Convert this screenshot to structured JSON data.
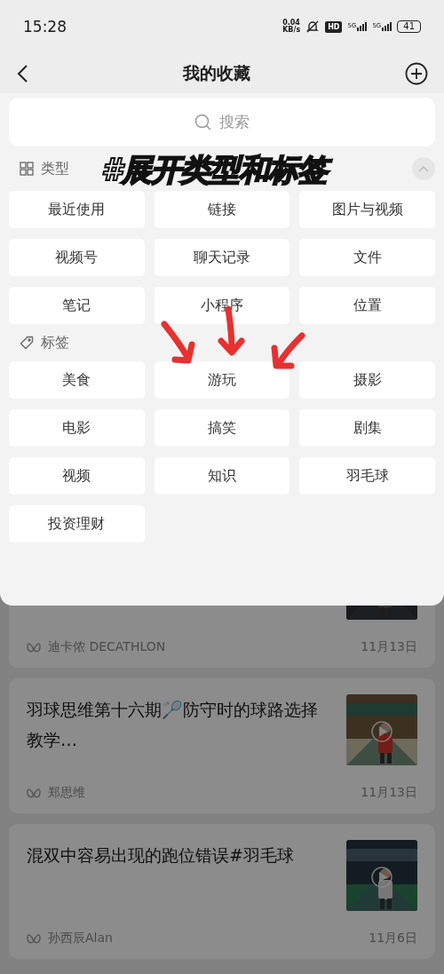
{
  "status_bar": {
    "time": "15:28",
    "net_speed": [
      "0.04",
      "KB/s"
    ],
    "hd": "HD",
    "signals": [
      "5G",
      "5G"
    ],
    "battery": "41"
  },
  "header": {
    "title": "我的收藏"
  },
  "search": {
    "placeholder": "搜索"
  },
  "sections": [
    {
      "kind": "types",
      "title": "类型",
      "expanded": true,
      "items": [
        "最近使用",
        "链接",
        "图片与视频",
        "视频号",
        "聊天记录",
        "文件",
        "笔记",
        "小程序",
        "位置"
      ]
    },
    {
      "kind": "tags",
      "title": "标签",
      "items": [
        "美食",
        "游玩",
        "摄影",
        "电影",
        "搞笑",
        "剧集",
        "视频",
        "知识",
        "羽毛球",
        "投资理财"
      ]
    }
  ],
  "annotation": {
    "caption": "#展开类型和标签"
  },
  "list": [
    {
      "author": "迪卡侬 DECATHLON",
      "date": "11月13日"
    },
    {
      "title": "羽球思维第十六期🏸防守时的球路选择教学…",
      "author": "郑思维",
      "date": "11月13日"
    },
    {
      "title": "混双中容易出现的跑位错误#羽毛球",
      "author": "孙西辰Alan",
      "date": "11月6日"
    }
  ]
}
